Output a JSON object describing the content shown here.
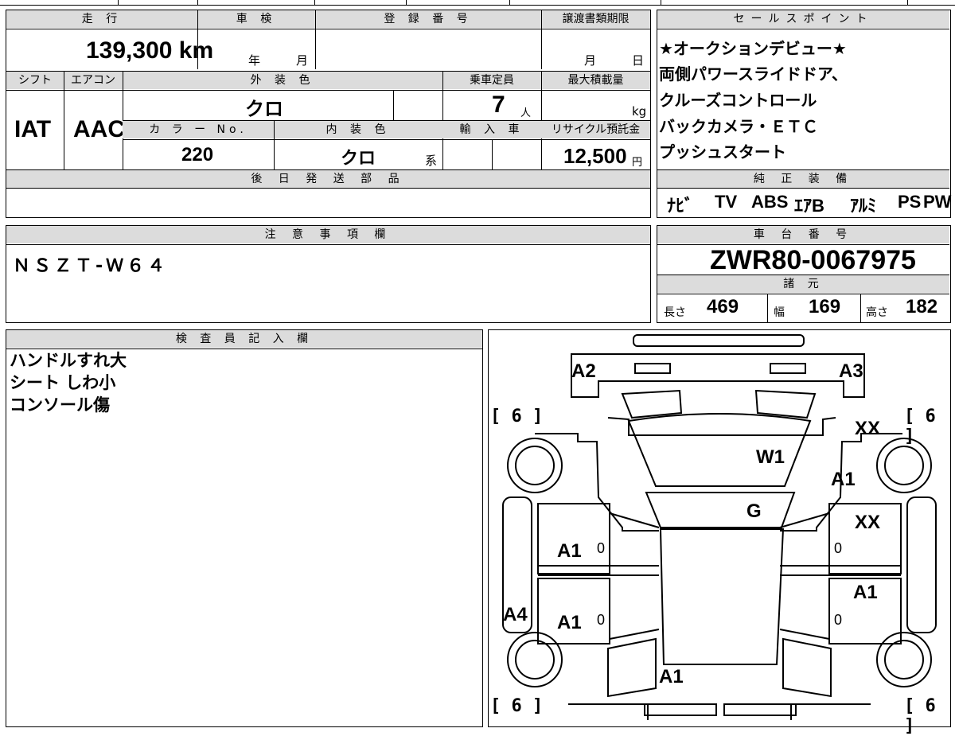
{
  "vehicle_info": {
    "mileage": {
      "header": "走 行",
      "value": "139,300 km"
    },
    "inspection": {
      "header": "車 検",
      "year_unit": "年",
      "month_unit": "月"
    },
    "registration_number": {
      "header": "登 録 番 号"
    },
    "transfer_deadline": {
      "header": "譲渡書類期限",
      "month_unit": "月",
      "day_unit": "日"
    },
    "shift": {
      "header": "シフト",
      "value": "IAT"
    },
    "aircon": {
      "header": "エアコン",
      "value": "AAC"
    },
    "exterior_color": {
      "header": "外 装 色",
      "value": "クロ"
    },
    "capacity": {
      "header": "乗車定員",
      "value": "7",
      "unit": "人"
    },
    "max_load": {
      "header": "最大積載量",
      "unit": "kg"
    },
    "color_no": {
      "header": "カ ラ ー No.",
      "value": "220"
    },
    "interior_color": {
      "header": "内 装 色",
      "value": "クロ",
      "unit": "系"
    },
    "import": {
      "header": "輸 入 車"
    },
    "recycle_fee": {
      "header": "リサイクル預託金",
      "value": "12,500",
      "unit": "円"
    },
    "later_parts": {
      "header": "後 日 発 送 部 品"
    }
  },
  "sales_points": {
    "header": "セールスポイント",
    "lines": [
      "★オークションデビュー★",
      "両側パワースライドドア、",
      "クルーズコントロール",
      "バックカメラ・ＥＴＣ",
      "プッシュスタート"
    ]
  },
  "genuine_equipment": {
    "header": "純 正 装 備",
    "items": [
      "ﾅﾋﾞ",
      "TV",
      "ABS",
      "ｴｱB",
      "ｱﾙﾐ",
      "PS",
      "PW"
    ]
  },
  "notes": {
    "header": "注 意 事 項 欄",
    "value": "ＮＳＺＴ-Ｗ６４"
  },
  "chassis": {
    "header": "車 台 番 号",
    "value": "ZWR80-0067975",
    "spec_header": "諸 元",
    "length_label": "長さ",
    "length": "469",
    "width_label": "幅",
    "width": "169",
    "height_label": "高さ",
    "height": "182"
  },
  "inspector": {
    "header": "検 査 員 記 入 欄",
    "lines": [
      "ハンドルすれ大",
      "シート しわ小",
      "コンソール傷"
    ]
  },
  "diagram": {
    "tire_marks": [
      "[ 6 ]",
      "[ 6 ]",
      "[ 6 ]",
      "[ 6 ]"
    ],
    "marks": [
      "A2",
      "A3",
      "XX",
      "W1",
      "A1",
      "G",
      "XX",
      "A1",
      "A1",
      "A4",
      "A1",
      "A1"
    ],
    "zeros": [
      "0",
      "0",
      "0",
      "0"
    ]
  }
}
